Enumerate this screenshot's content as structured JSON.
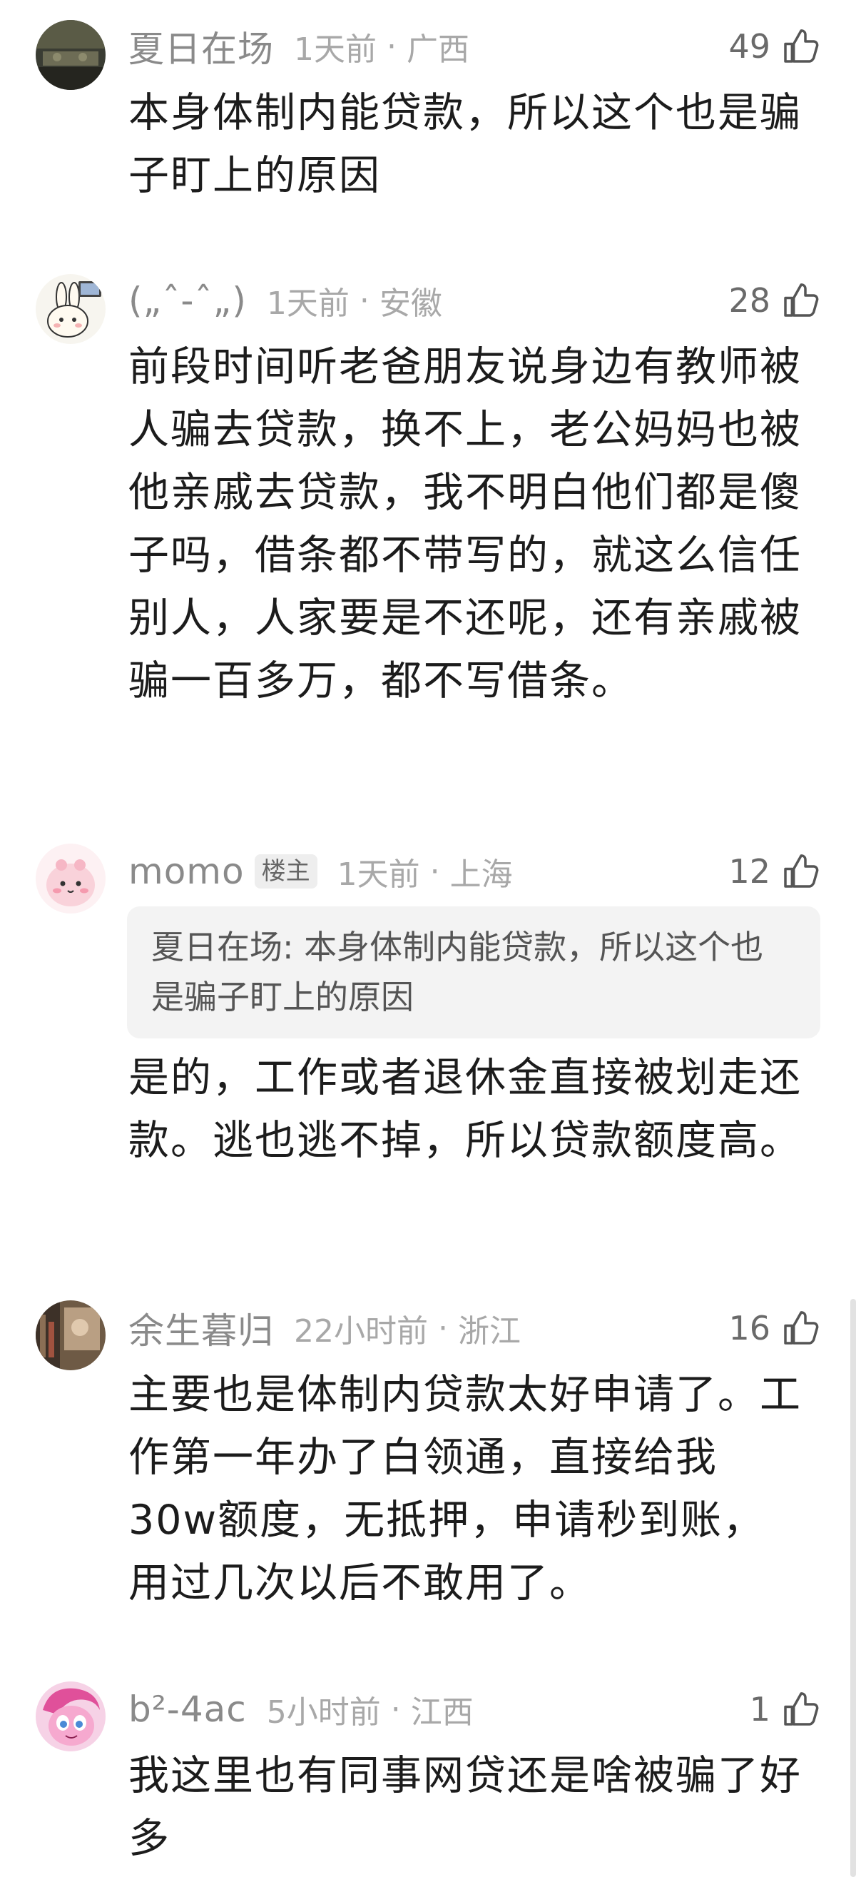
{
  "comments": [
    {
      "username": "夏日在场",
      "time": "1天前",
      "location": "广西",
      "likes": "49",
      "text": "本身体制内能贷款，所以这个也是骗子盯上的原因",
      "avatar_icon": "photo-avatar-icon"
    },
    {
      "username": "(„ˆ-ˆ„)",
      "time": "1天前",
      "location": "安徽",
      "likes": "28",
      "text": "前段时间听老爸朋友说身边有教师被人骗去贷款，换不上，老公妈妈也被他亲戚去贷款，我不明白他们都是傻子吗，借条都不带写的，就这么信任别人，人家要是不还呢，还有亲戚被骗一百多万，都不写借条。",
      "avatar_icon": "rabbit-avatar-icon"
    },
    {
      "username": "momo",
      "op_badge": "楼主",
      "time": "1天前",
      "location": "上海",
      "likes": "12",
      "quote_name": "夏日在场:",
      "quote_text": "本身体制内能贷款，所以这个也是骗子盯上的原因",
      "text": "是的，工作或者退休金直接被划走还款。逃也逃不掉，所以贷款额度高。",
      "avatar_icon": "pink-character-avatar-icon"
    },
    {
      "username": "余生暮归",
      "time": "22小时前",
      "location": "浙江",
      "likes": "16",
      "text": "主要也是体制内贷款太好申请了。工作第一年办了白领通，直接给我30w额度，无抵押，申请秒到账，用过几次以后不敢用了。",
      "avatar_icon": "photo-avatar-icon"
    },
    {
      "username": "b²-4ac",
      "time": "5小时前",
      "location": "江西",
      "likes": "1",
      "text": "我这里也有同事网贷还是啥被骗了好多",
      "avatar_icon": "pony-avatar-icon"
    }
  ],
  "separator_dot": "·",
  "like_icon": "thumbs-up-icon",
  "colors": {
    "username": "#8a8a8a",
    "meta": "#a8a8a8",
    "body": "#1c1c1c",
    "quote_bg": "#f3f3f3"
  }
}
